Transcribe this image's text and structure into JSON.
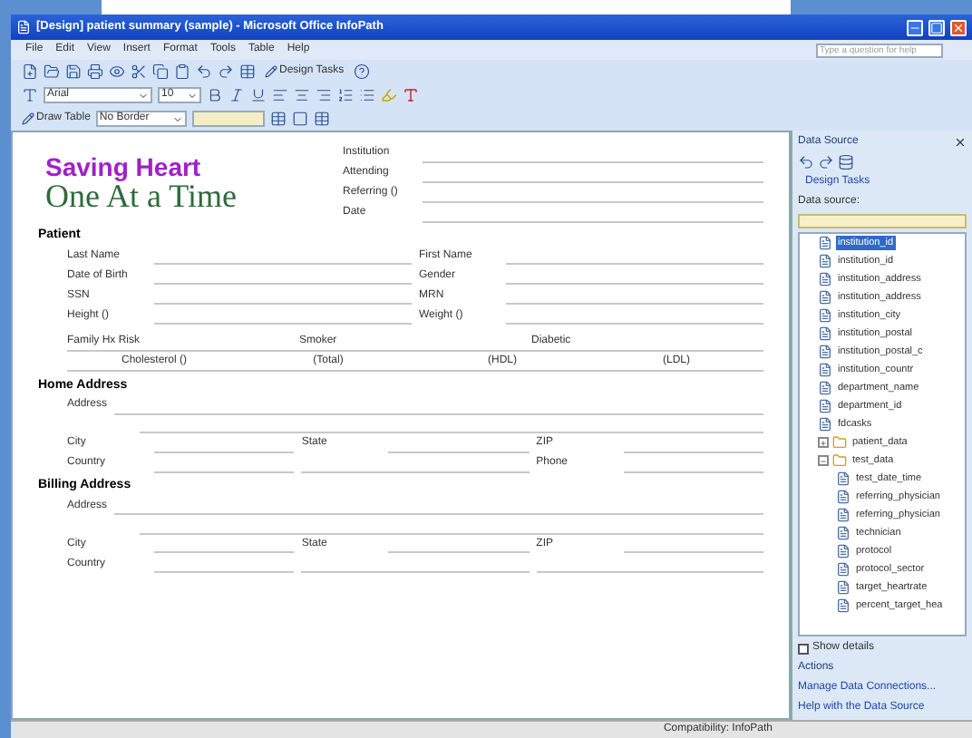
{
  "window": {
    "title": "[Design] patient summary (sample) - Microsoft Office InfoPath"
  },
  "menu": [
    "File",
    "Edit",
    "View",
    "Insert",
    "Format",
    "Tools",
    "Table",
    "Help"
  ],
  "help_search": {
    "placeholder": "Type a question for help"
  },
  "toolbar": {
    "design_tasks": "Design Tasks",
    "font": "Arial",
    "size": "10",
    "draw_table": "Draw Table",
    "border": "No Border"
  },
  "logo": {
    "line1": "Saving Heart",
    "line2": "One At a Time"
  },
  "header_fields": [
    "Institution",
    "Attending",
    "Referring ()",
    "Date"
  ],
  "sections": [
    {
      "title": "Patient",
      "rows": [
        [
          "Last Name",
          "First Name"
        ],
        [
          "Date of Birth",
          "Gender"
        ],
        [
          "SSN",
          "MRN"
        ],
        [
          "Height ()",
          "Weight ()"
        ]
      ],
      "risk": {
        "labels": [
          "Family Hx Risk",
          "Smoker",
          "Diabetic"
        ],
        "cholesterol": [
          "Cholesterol ()",
          "(Total)",
          "(HDL)",
          "(LDL)"
        ]
      }
    },
    {
      "title": "Home Address",
      "address": "Address",
      "rows": [
        [
          "City",
          "State",
          "ZIP"
        ],
        [
          "Country",
          "",
          "Phone"
        ]
      ]
    },
    {
      "title": "Billing Address",
      "address": "Address",
      "rows": [
        [
          "City",
          "State",
          "ZIP"
        ],
        [
          "Country",
          "",
          ""
        ]
      ]
    }
  ],
  "task_pane": {
    "title": "Data Source",
    "design_tasks": "Design Tasks",
    "source_label": "Data source:",
    "tree": [
      {
        "label": "institution_id",
        "kind": "field",
        "selected": true
      },
      {
        "label": "institution_id",
        "kind": "field",
        "selected": false
      },
      {
        "label": "institution_address",
        "kind": "field",
        "selected": false
      },
      {
        "label": "institution_address",
        "kind": "field",
        "selected": false
      },
      {
        "label": "institution_city",
        "kind": "field",
        "selected": false
      },
      {
        "label": "institution_postal",
        "kind": "field",
        "selected": false
      },
      {
        "label": "institution_postal_c",
        "kind": "field",
        "selected": false
      },
      {
        "label": "institution_countr",
        "kind": "field",
        "selected": false
      },
      {
        "label": "department_name",
        "kind": "field",
        "selected": false
      },
      {
        "label": "department_id",
        "kind": "field",
        "selected": false
      },
      {
        "label": "fdcasks",
        "kind": "field",
        "selected": false
      },
      {
        "label": "patient_data",
        "kind": "folder",
        "selected": false,
        "expanded": false
      },
      {
        "label": "test_data",
        "kind": "folder",
        "selected": false,
        "expanded": true,
        "children": [
          {
            "label": "test_date_time",
            "kind": "field",
            "selected": false
          },
          {
            "label": "referring_physician",
            "kind": "field",
            "selected": false
          },
          {
            "label": "referring_physician",
            "kind": "field",
            "selected": false
          },
          {
            "label": "technician",
            "kind": "field",
            "selected": false
          },
          {
            "label": "protocol",
            "kind": "field",
            "selected": false
          },
          {
            "label": "protocol_sector",
            "kind": "field",
            "selected": false
          },
          {
            "label": "target_heartrate",
            "kind": "field",
            "selected": false
          },
          {
            "label": "percent_target_hea",
            "kind": "field",
            "selected": false
          }
        ]
      }
    ],
    "show_details": {
      "label": "Show details",
      "checked": false
    },
    "actions_label": "Actions",
    "links": [
      "Manage Data Connections...",
      "Help with the Data Source"
    ]
  },
  "status_bar": {
    "text": "Compatibility: InfoPath"
  }
}
